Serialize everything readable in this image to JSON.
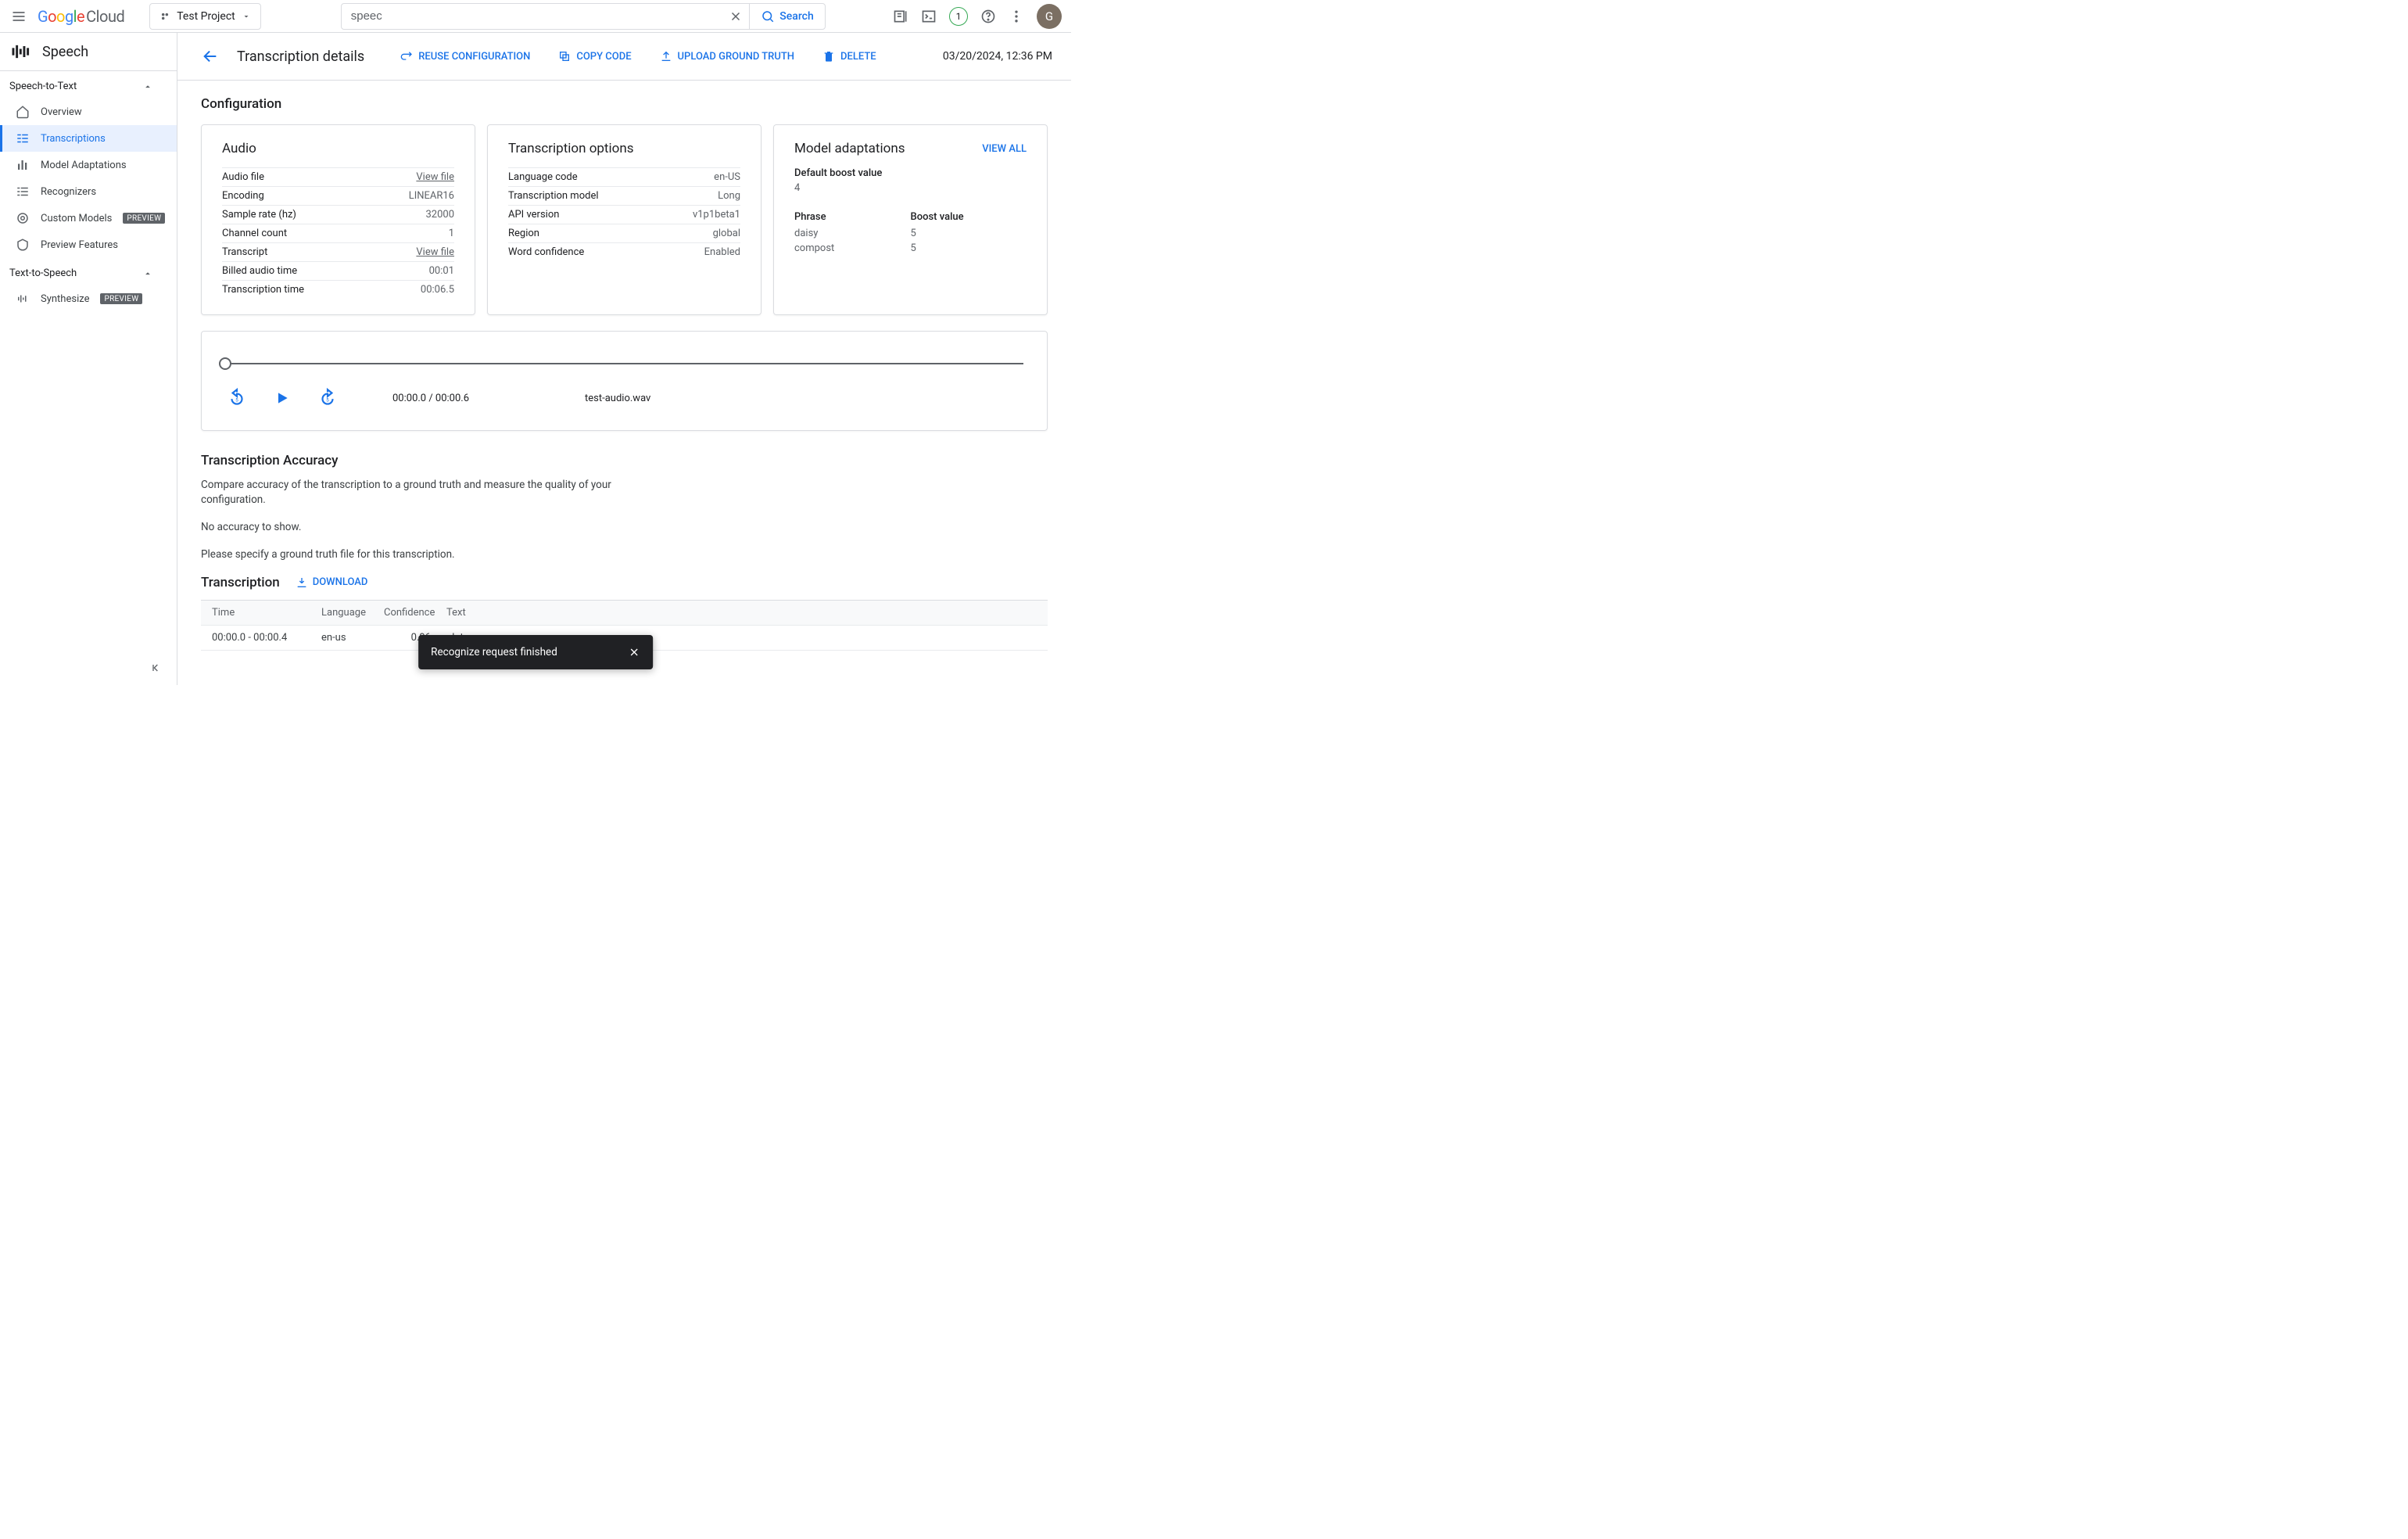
{
  "topbar": {
    "logo_cloud": "Cloud",
    "project": "Test Project",
    "search_value": "speec",
    "search_btn": "Search",
    "notif_count": "1",
    "avatar_letter": "G"
  },
  "sidebar": {
    "product": "Speech",
    "section1": "Speech-to-Text",
    "items1": [
      {
        "label": "Overview"
      },
      {
        "label": "Transcriptions"
      },
      {
        "label": "Model Adaptations"
      },
      {
        "label": "Recognizers"
      },
      {
        "label": "Custom Models",
        "badge": "PREVIEW"
      },
      {
        "label": "Preview Features"
      }
    ],
    "section2": "Text-to-Speech",
    "items2": [
      {
        "label": "Synthesize",
        "badge": "PREVIEW"
      }
    ]
  },
  "header": {
    "title": "Transcription details",
    "actions": {
      "reuse": "REUSE CONFIGURATION",
      "copy": "COPY CODE",
      "upload": "UPLOAD GROUND TRUTH",
      "delete": "DELETE"
    },
    "timestamp": "03/20/2024, 12:36 PM"
  },
  "config": {
    "title": "Configuration",
    "audio": {
      "title": "Audio",
      "rows": {
        "audio_file_k": "Audio file",
        "audio_file_v": "View file",
        "encoding_k": "Encoding",
        "encoding_v": "LINEAR16",
        "sr_k": "Sample rate (hz)",
        "sr_v": "32000",
        "cc_k": "Channel count",
        "cc_v": "1",
        "tr_k": "Transcript",
        "tr_v": "View file",
        "bat_k": "Billed audio time",
        "bat_v": "00:01",
        "tt_k": "Transcription time",
        "tt_v": "00:06.5"
      }
    },
    "options": {
      "title": "Transcription options",
      "rows": {
        "lang_k": "Language code",
        "lang_v": "en-US",
        "model_k": "Transcription model",
        "model_v": "Long",
        "api_k": "API version",
        "api_v": "v1p1beta1",
        "region_k": "Region",
        "region_v": "global",
        "wc_k": "Word confidence",
        "wc_v": "Enabled"
      }
    },
    "adapt": {
      "title": "Model adaptations",
      "view_all": "VIEW ALL",
      "default_boost_label": "Default boost value",
      "default_boost": "4",
      "phrase_hdr": "Phrase",
      "boost_hdr": "Boost value",
      "rows": [
        {
          "phrase": "daisy",
          "boost": "5"
        },
        {
          "phrase": "compost",
          "boost": "5"
        }
      ]
    }
  },
  "player": {
    "time": "00:00.0 / 00:00.6",
    "file": "test-audio.wav"
  },
  "accuracy": {
    "title": "Transcription Accuracy",
    "desc": "Compare accuracy of the transcription to a ground truth and measure the quality of your configuration.",
    "none": "No accuracy to show.",
    "hint": "Please specify a ground truth file for this transcription."
  },
  "transcription": {
    "title": "Transcription",
    "download": "DOWNLOAD",
    "headers": {
      "time": "Time",
      "lang": "Language",
      "conf": "Confidence",
      "text": "Text"
    },
    "row": {
      "time": "00:00.0 - 00:00.4",
      "lang": "en-us",
      "conf": "0.96",
      "text": "plat"
    }
  },
  "toast": {
    "message": "Recognize request finished"
  }
}
